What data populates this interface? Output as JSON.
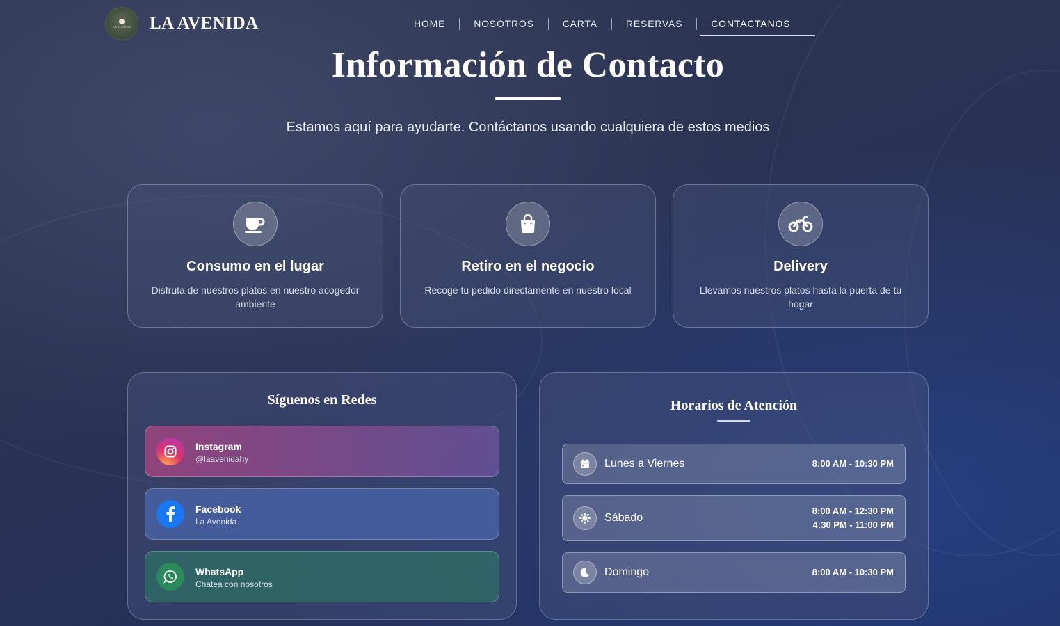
{
  "nav": {
    "logo_text": "LA AVENIDA",
    "brand": "LA AVENIDA",
    "items": [
      {
        "label": "HOME"
      },
      {
        "label": "NOSOTROS"
      },
      {
        "label": "CARTA"
      },
      {
        "label": "RESERVAS"
      },
      {
        "label": "CONTACTANOS",
        "active": true
      }
    ]
  },
  "hero": {
    "title": "Información de Contacto",
    "subtitle": "Estamos aquí para ayudarte. Contáctanos usando cualquiera de estos medios"
  },
  "services": [
    {
      "icon": "coffee-cup-icon",
      "title": "Consumo en el lugar",
      "description": "Disfruta de nuestros platos en nuestro acogedor ambiente"
    },
    {
      "icon": "shopping-bag-icon",
      "title": "Retiro en el negocio",
      "description": "Recoge tu pedido directamente en nuestro local"
    },
    {
      "icon": "motorcycle-icon",
      "title": "Delivery",
      "description": "Llevamos nuestros platos hasta la puerta de tu hogar"
    }
  ],
  "social": {
    "title": "Síguenos en Redes",
    "items": [
      {
        "icon": "instagram-icon",
        "name": "Instagram",
        "handle": "@laavenidahy"
      },
      {
        "icon": "facebook-icon",
        "name": "Facebook",
        "handle": "La Avenida"
      },
      {
        "icon": "whatsapp-icon",
        "name": "WhatsApp",
        "handle": "Chatea con nosotros"
      }
    ]
  },
  "hours": {
    "title": "Horarios de Atención",
    "rows": [
      {
        "icon": "calendar-icon",
        "day": "Lunes a Viernes",
        "times": [
          "8:00 AM - 10:30 PM"
        ]
      },
      {
        "icon": "sun-icon",
        "day": "Sábado",
        "times": [
          "8:00 AM - 12:30 PM",
          "4:30 PM - 11:00 PM"
        ]
      },
      {
        "icon": "moon-icon",
        "day": "Domingo",
        "times": [
          "8:00 AM - 10:30 PM"
        ]
      }
    ]
  },
  "colors": {
    "instagram_gradient_start": "#a0447f",
    "instagram_gradient_end": "#6e54a0",
    "facebook": "#4863a8",
    "whatsapp": "#2f6a66"
  }
}
